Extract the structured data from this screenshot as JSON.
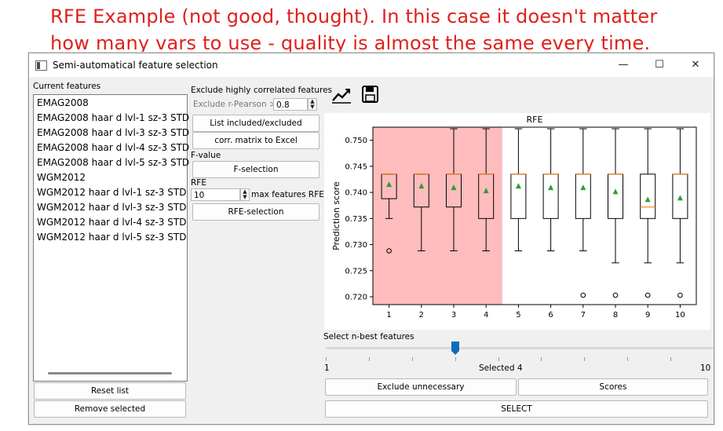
{
  "annotation": {
    "line1": "RFE Example (not good, thought). In this case it doesn't matter",
    "line2": "how many vars to use - quality is almost the same every time."
  },
  "window": {
    "title": "Semi-automatical feature selection",
    "min_symbol": "—",
    "max_symbol": "☐",
    "close_symbol": "✕"
  },
  "left_panel": {
    "label": "Current features",
    "features": [
      "EMAG2008",
      "EMAG2008 haar d lvl-1 sz-3 STD",
      "EMAG2008 haar d lvl-3 sz-3 STD",
      "EMAG2008 haar d lvl-4 sz-3 STD",
      "EMAG2008 haar d lvl-5 sz-3 STD",
      "WGM2012",
      "WGM2012 haar d lvl-1 sz-3 STD",
      "WGM2012 haar d lvl-3 sz-3 STD",
      "WGM2012 haar d lvl-4 sz-3 STD",
      "WGM2012 haar d lvl-5 sz-3 STD"
    ],
    "reset_label": "Reset list",
    "remove_label": "Remove selected"
  },
  "middle_panel": {
    "corr_header": "Exclude highly correlated features",
    "r_label": "Exclude r-Pearson >",
    "r_value": "0.8",
    "list_button": "List included/excluded",
    "corr_button": "corr. matrix to Excel",
    "fvalue_header": "F-value",
    "fselect_button": "F-selection",
    "rfe_header": "RFE",
    "rfe_value": "10",
    "rfe_max_label": "max features RFE",
    "rfe_button": "RFE-selection"
  },
  "toolbar": {
    "chart_icon": "line-chart-icon",
    "save_icon": "floppy-disk-icon"
  },
  "chart_data": {
    "type": "box",
    "title": "RFE",
    "ylabel": "Prediction score",
    "xlabel": "",
    "categories": [
      "1",
      "2",
      "3",
      "4",
      "5",
      "6",
      "7",
      "8",
      "9",
      "10"
    ],
    "ylim": [
      0.7185,
      0.7525
    ],
    "yticks": [
      "0.750",
      "0.745",
      "0.740",
      "0.735",
      "0.730",
      "0.725",
      "0.720"
    ],
    "ytick_values": [
      0.75,
      0.745,
      0.74,
      0.735,
      0.73,
      0.725,
      0.72
    ],
    "highlight_range": [
      "1",
      "4"
    ],
    "highlight_color": "#ffbcbc",
    "box_color": "#000000",
    "median_color": "#ff7f0e",
    "mean_color": "#2ca02c",
    "grid": false,
    "boxes": [
      {
        "whislo": 0.735,
        "q1": 0.7388,
        "med": 0.7435,
        "q3": 0.7435,
        "whishi": 0.7435,
        "mean": 0.7415,
        "fliers": [
          0.7288
        ]
      },
      {
        "whislo": 0.7288,
        "q1": 0.7372,
        "med": 0.7435,
        "q3": 0.7435,
        "whishi": 0.7435,
        "mean": 0.7412,
        "fliers": []
      },
      {
        "whislo": 0.7288,
        "q1": 0.7372,
        "med": 0.7435,
        "q3": 0.7435,
        "whishi": 0.7522,
        "mean": 0.7409,
        "fliers": []
      },
      {
        "whislo": 0.7288,
        "q1": 0.735,
        "med": 0.7435,
        "q3": 0.7435,
        "whishi": 0.7522,
        "mean": 0.7403,
        "fliers": []
      },
      {
        "whislo": 0.7288,
        "q1": 0.735,
        "med": 0.7435,
        "q3": 0.7435,
        "whishi": 0.7522,
        "mean": 0.7412,
        "fliers": []
      },
      {
        "whislo": 0.7288,
        "q1": 0.735,
        "med": 0.7435,
        "q3": 0.7435,
        "whishi": 0.7522,
        "mean": 0.7409,
        "fliers": []
      },
      {
        "whislo": 0.7288,
        "q1": 0.735,
        "med": 0.7435,
        "q3": 0.7435,
        "whishi": 0.7522,
        "mean": 0.7409,
        "fliers": [
          0.7203
        ]
      },
      {
        "whislo": 0.7265,
        "q1": 0.735,
        "med": 0.7435,
        "q3": 0.7435,
        "whishi": 0.7522,
        "mean": 0.7401,
        "fliers": [
          0.7203
        ]
      },
      {
        "whislo": 0.7265,
        "q1": 0.735,
        "med": 0.7372,
        "q3": 0.7435,
        "whishi": 0.7522,
        "mean": 0.7386,
        "fliers": [
          0.7203
        ]
      },
      {
        "whislo": 0.7265,
        "q1": 0.735,
        "med": 0.7435,
        "q3": 0.7435,
        "whishi": 0.7522,
        "mean": 0.7389,
        "fliers": [
          0.7203
        ]
      }
    ]
  },
  "slider": {
    "label": "Select n-best features",
    "min_label": "1",
    "max_label": "10",
    "min": 1,
    "max": 10,
    "value": 4,
    "selected_text": "Selected 4"
  },
  "bottom": {
    "exclude_label": "Exclude unnecessary",
    "scores_label": "Scores",
    "select_label": "SELECT"
  }
}
